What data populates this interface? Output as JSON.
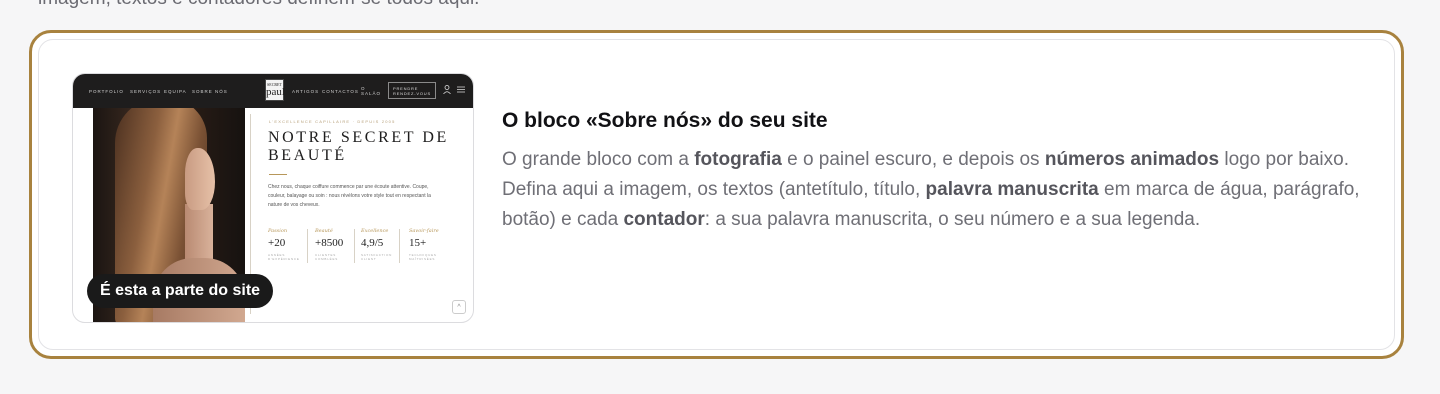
{
  "top_caption": "imagem, textos e contadores definem-se todos aqui.",
  "preview": {
    "nav": {
      "links_left": [
        "PORTFOLIO",
        "SERVIÇOS",
        "EQUIPA",
        "SOBRE NÓS"
      ],
      "logo_line1": "SECRET",
      "logo_line2": "paul",
      "links_right": [
        "ARTIGOS",
        "CONTACTOS",
        "O SALÃO"
      ],
      "cta_label": "PRENDRE RENDEZ-VOUS"
    },
    "small_top": "L'EXCELLENCE CAPILLAIRE · DEPUIS 2005",
    "title": "NOTRE SECRET DE BEAUTÉ",
    "paragraph": "Chez nous, chaque coiffure commence par une écoute attentive. Coupe, couleur, balayage ou soin : nous révélons votre style tout en respectant la nature de vos cheveux.",
    "stats": [
      {
        "script": "Passion",
        "num": "+20",
        "cap": "ANNÉES D'EXPÉRIENCE"
      },
      {
        "script": "Beauté",
        "num": "+8500",
        "cap": "CLIENTES COMBLÉES"
      },
      {
        "script": "Excellence",
        "num": "4,9/5",
        "cap": "SATISFACTION CLIENT"
      },
      {
        "script": "Savoir-faire",
        "num": "15+",
        "cap": "TECHNIQUES MAÎTRISÉES"
      }
    ],
    "up_button": "^"
  },
  "pill_label": "É esta a parte do site",
  "heading": "O bloco «Sobre nós» do seu site",
  "description": {
    "t1": "O grande bloco com a ",
    "b1": "fotografia",
    "t2": " e o painel escuro, e depois os ",
    "b2": "números animados",
    "t3": " logo por baixo. Defina aqui a imagem, os textos (antetítulo, título, ",
    "b3": "palavra manuscrita",
    "t4": " em marca de água, parágrafo, botão) e cada ",
    "b4": "contador",
    "t5": ": a sua palavra manuscrita, o seu número e a sua legenda."
  },
  "colors": {
    "accent_border": "#a8823e",
    "dark": "#1a1a1a"
  }
}
